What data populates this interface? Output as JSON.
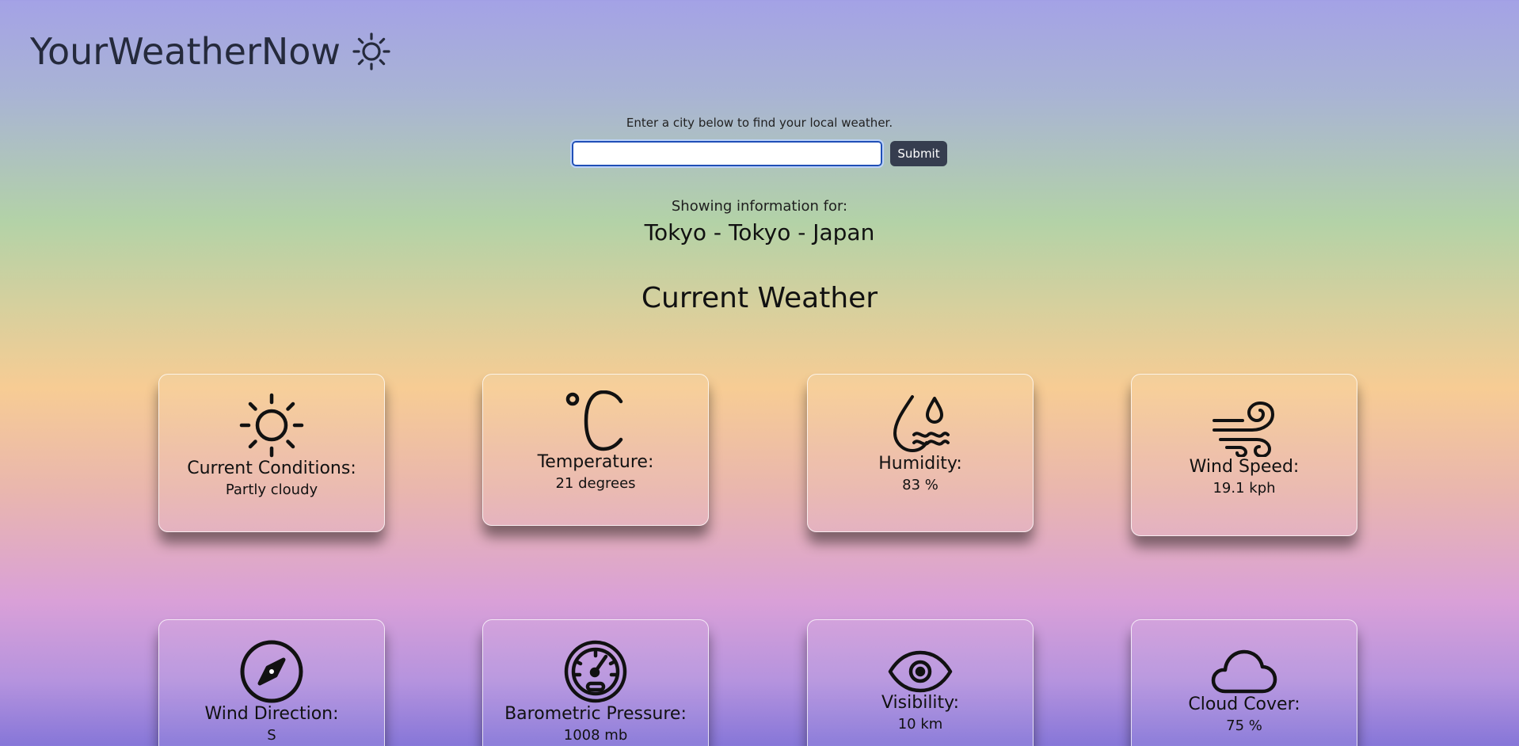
{
  "header": {
    "brand_title": "YourWeatherNow",
    "brand_icon": "sun-icon"
  },
  "search": {
    "prompt": "Enter a city below to find your local weather.",
    "input_value": "",
    "submit_label": "Submit",
    "input_border_color": "#1f4fb7",
    "button_color": "#363d4f"
  },
  "location": {
    "showing_label": "Showing information for:",
    "name": "Tokyo - Tokyo - Japan"
  },
  "section_title": "Current Weather",
  "cards": [
    {
      "label": "Current Conditions:",
      "value": "Partly cloudy",
      "icon": "sun-icon"
    },
    {
      "label": "Temperature:",
      "value": "21 degrees",
      "icon": "celsius-icon"
    },
    {
      "label": "Humidity:",
      "value": "83 %",
      "icon": "humidity-icon"
    },
    {
      "label": "Wind Speed:",
      "value": "19.1 kph",
      "icon": "wind-icon"
    },
    {
      "label": "Wind Direction:",
      "value": "S",
      "icon": "compass-icon"
    },
    {
      "label": "Barometric Pressure:",
      "value": "1008 mb",
      "icon": "gauge-icon"
    },
    {
      "label": "Visibility:",
      "value": "10 km",
      "icon": "eye-icon"
    },
    {
      "label": "Cloud Cover:",
      "value": "75 %",
      "icon": "cloud-icon"
    }
  ]
}
